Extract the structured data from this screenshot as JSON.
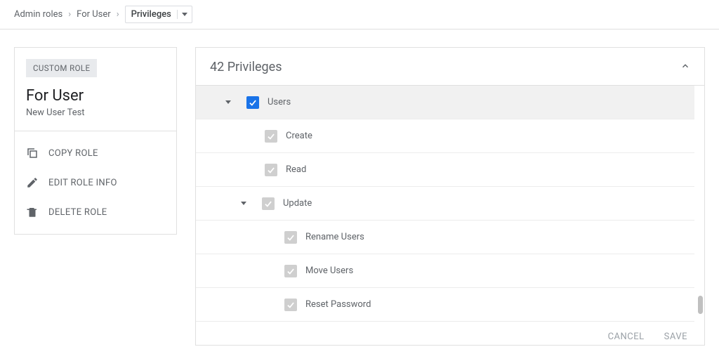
{
  "breadcrumb": {
    "items": [
      "Admin roles",
      "For User"
    ],
    "current": "Privileges"
  },
  "sidebar": {
    "badge": "CUSTOM ROLE",
    "title": "For User",
    "subtitle": "New User Test",
    "actions": {
      "copy": "COPY ROLE",
      "edit": "EDIT ROLE INFO",
      "delete": "DELETE ROLE"
    }
  },
  "main": {
    "title": "42 Privileges",
    "privileges": [
      {
        "label": "Users",
        "level": 0,
        "checked": true,
        "active": true,
        "expandable": true
      },
      {
        "label": "Create",
        "level": 1,
        "checked": true,
        "active": false,
        "expandable": false
      },
      {
        "label": "Read",
        "level": 1,
        "checked": true,
        "active": false,
        "expandable": false
      },
      {
        "label": "Update",
        "level": 1,
        "checked": true,
        "active": false,
        "expandable": true
      },
      {
        "label": "Rename Users",
        "level": 2,
        "checked": true,
        "active": false,
        "expandable": false
      },
      {
        "label": "Move Users",
        "level": 2,
        "checked": true,
        "active": false,
        "expandable": false
      },
      {
        "label": "Reset Password",
        "level": 2,
        "checked": true,
        "active": false,
        "expandable": false
      }
    ]
  },
  "footer": {
    "cancel": "CANCEL",
    "save": "SAVE"
  }
}
